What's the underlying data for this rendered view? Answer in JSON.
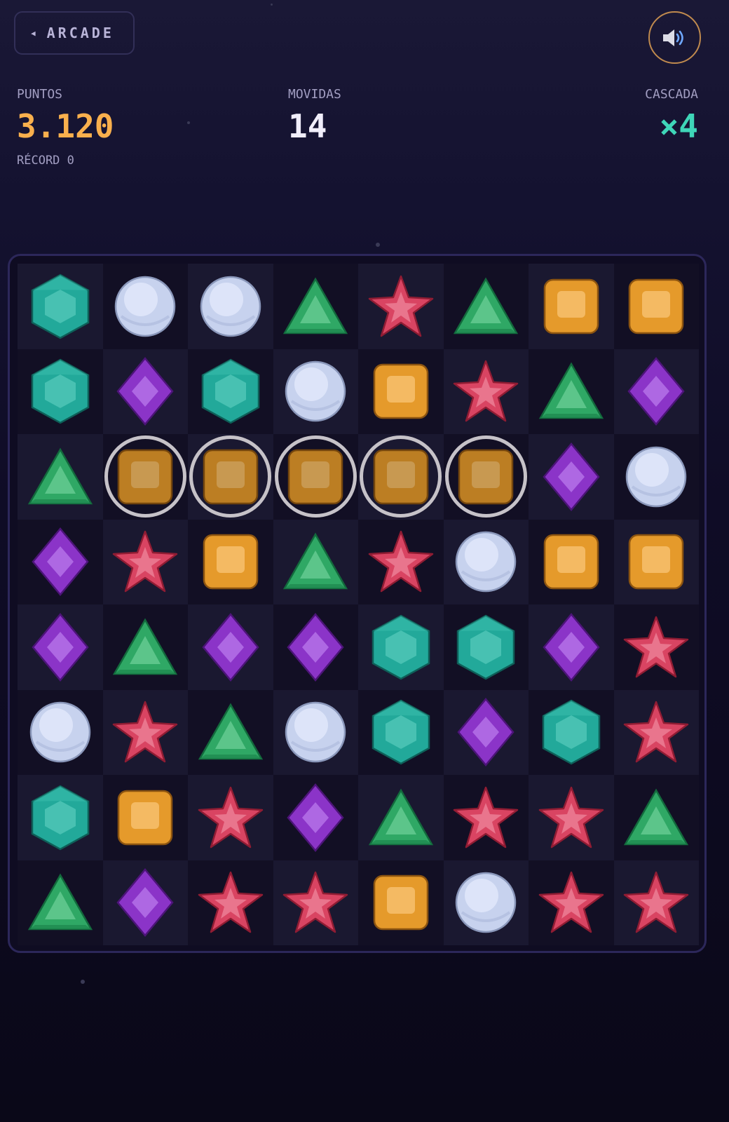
{
  "header": {
    "back_label": "ARCADE",
    "back_icon": "left-triangle-icon",
    "sound_icon": "speaker-icon"
  },
  "stats": {
    "score_label": "PUNTOS",
    "score_value": "3.120",
    "moves_label": "MOVIDAS",
    "moves_value": "14",
    "cascade_label": "CASCADA",
    "cascade_value": "×4",
    "record_label": "RÉCORD 0"
  },
  "colors": {
    "score": "#f9b04d",
    "moves": "#f1eefb",
    "cascade": "#3fd6b8",
    "hexagon": "#22a99a",
    "orb": "#c7d2ee",
    "triangle": "#2fa865",
    "star": "#d94462",
    "square": "#e59a2b",
    "diamond": "#8b34c8"
  },
  "board": {
    "size": 8,
    "rows": [
      [
        "hexagon",
        "orb",
        "orb",
        "triangle",
        "star",
        "triangle",
        "square",
        "square"
      ],
      [
        "hexagon",
        "diamond",
        "hexagon",
        "orb",
        "square",
        "star",
        "triangle",
        "diamond"
      ],
      [
        "triangle",
        "square",
        "square",
        "square",
        "square",
        "square",
        "diamond",
        "orb"
      ],
      [
        "diamond",
        "star",
        "square",
        "triangle",
        "star",
        "orb",
        "square",
        "square"
      ],
      [
        "diamond",
        "triangle",
        "diamond",
        "diamond",
        "hexagon",
        "hexagon",
        "diamond",
        "star"
      ],
      [
        "orb",
        "star",
        "triangle",
        "orb",
        "hexagon",
        "diamond",
        "hexagon",
        "star"
      ],
      [
        "hexagon",
        "square",
        "star",
        "diamond",
        "triangle",
        "star",
        "star",
        "triangle"
      ],
      [
        "triangle",
        "diamond",
        "star",
        "star",
        "square",
        "orb",
        "star",
        "star"
      ]
    ],
    "matched": [
      [
        2,
        1
      ],
      [
        2,
        2
      ],
      [
        2,
        3
      ],
      [
        2,
        4
      ],
      [
        2,
        5
      ]
    ]
  }
}
